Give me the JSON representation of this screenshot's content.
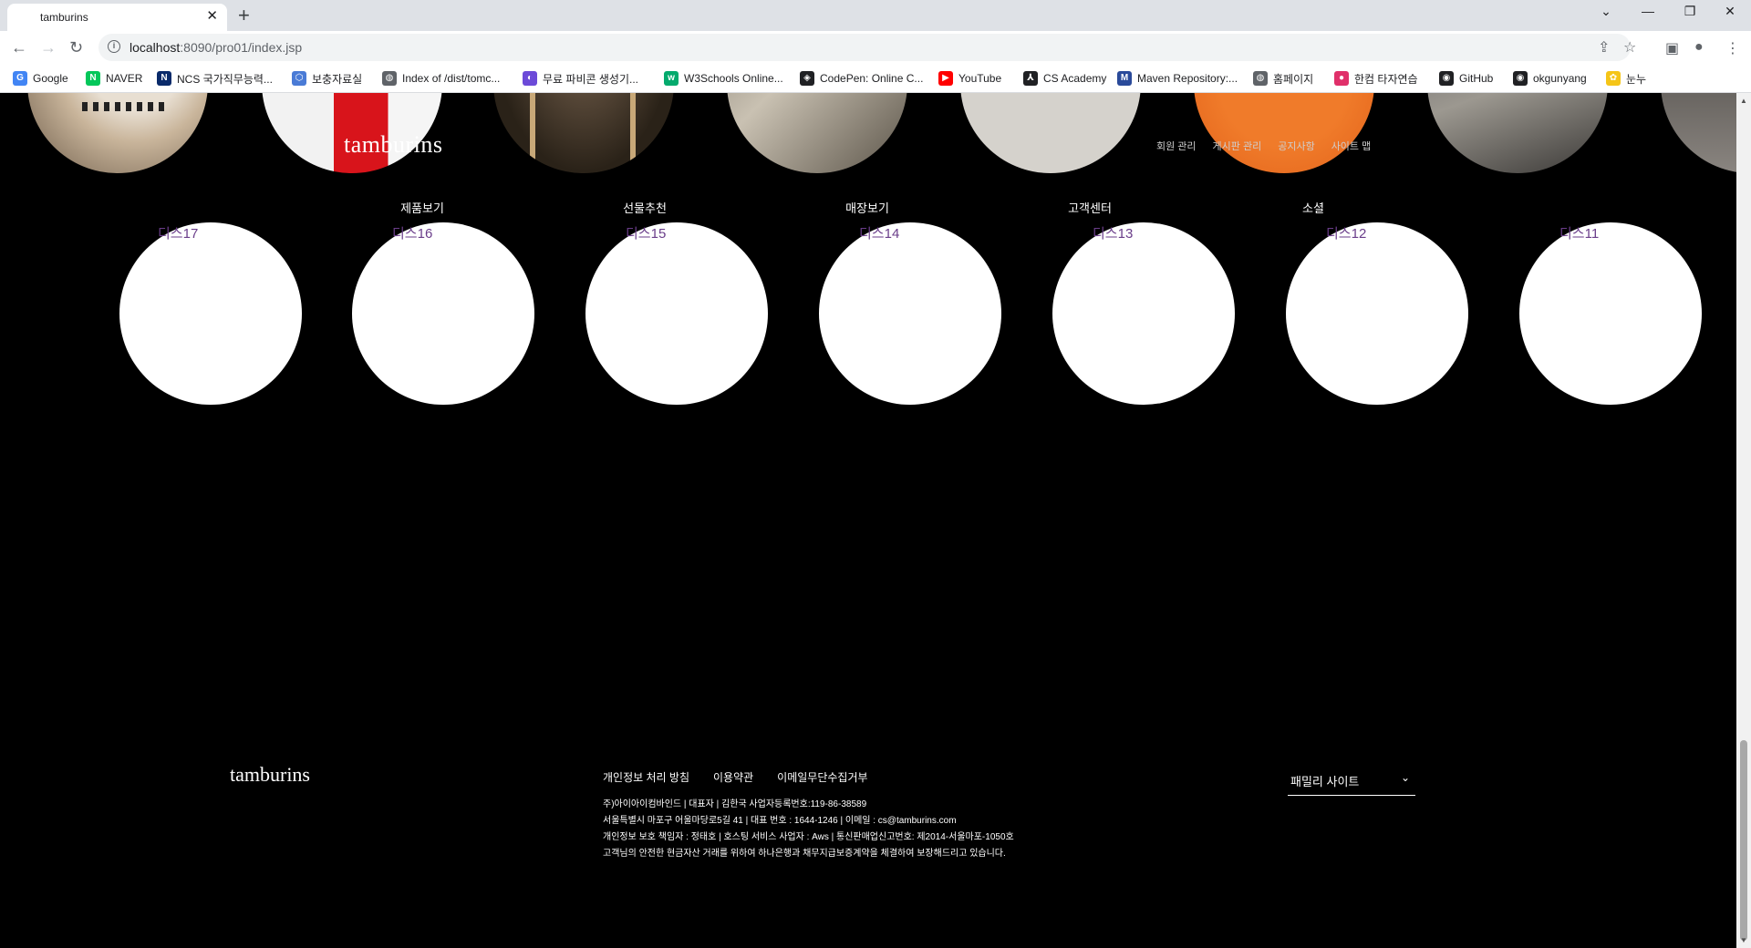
{
  "browser": {
    "tab_title": "tamburins",
    "url_host": "localhost",
    "url_path": ":8090/pro01/index.jsp",
    "bookmarks": [
      {
        "label": "Google",
        "icon": "google-icon",
        "color": "#4285f4"
      },
      {
        "label": "NAVER",
        "icon": "naver-icon",
        "color": "#03c75a"
      },
      {
        "label": "NCS 국가직무능력...",
        "icon": "ncs-icon",
        "color": "#0a2a6a"
      },
      {
        "label": "보충자료실",
        "icon": "hexagon-icon",
        "color": "#4a7bd6"
      },
      {
        "label": "Index of /dist/tomc...",
        "icon": "globe-icon",
        "color": "#5f6368"
      },
      {
        "label": "무료 파비콘 생성기...",
        "icon": "favicon-icon",
        "color": "#6c4ad8"
      },
      {
        "label": "W3Schools Online...",
        "icon": "w3schools-icon",
        "color": "#04aa6d"
      },
      {
        "label": "CodePen: Online C...",
        "icon": "codepen-icon",
        "color": "#202124"
      },
      {
        "label": "YouTube",
        "icon": "youtube-icon",
        "color": "#ff0000"
      },
      {
        "label": "CS Academy",
        "icon": "cs-academy-icon",
        "color": "#202124"
      },
      {
        "label": "Maven Repository:...",
        "icon": "maven-icon",
        "color": "#2a4a9a"
      },
      {
        "label": "홈페이지",
        "icon": "globe-icon",
        "color": "#5f6368"
      },
      {
        "label": "한컴 타자연습",
        "icon": "hancom-icon",
        "color": "#e0306a"
      },
      {
        "label": "GitHub",
        "icon": "github-icon",
        "color": "#202124"
      },
      {
        "label": "okgunyang",
        "icon": "github-icon",
        "color": "#202124"
      },
      {
        "label": "눈누",
        "icon": "noonnu-icon",
        "color": "#f5c518"
      }
    ]
  },
  "header": {
    "logo": "tamburins",
    "util_links": [
      "회원 관리",
      "게시판 관리",
      "공지사항",
      "사이트 맵"
    ]
  },
  "gnb": [
    "제품보기",
    "선물추천",
    "매장보기",
    "고객센터",
    "소셜"
  ],
  "circles": [
    "디스17",
    "디스16",
    "디스15",
    "디스14",
    "디스13",
    "디스12",
    "디스11"
  ],
  "footer": {
    "logo": "tamburins",
    "links": [
      "개인정보 처리 방침",
      "이용약관",
      "이메일무단수집거부"
    ],
    "info": [
      "주)아이아이컴바인드 | 대표자 | 김한국 사업자등록번호:119-86-38589",
      "서울특별시 마포구 어울마당로5길 41 | 대표 번호 : 1644-1246 | 이메일 : cs@tamburins.com",
      "개인정보 보호 책임자 : 정태호 | 호스팅 서비스 사업자 : Aws | 통신판매업신고번호: 제2014-서울마포-1050호",
      "고객님의 안전한 현금자산 거래를 위하여 하나은행과 채무지급보증계약을 체결하여 보장해드리고 있습니다."
    ],
    "family_site": "패밀리 사이트"
  }
}
